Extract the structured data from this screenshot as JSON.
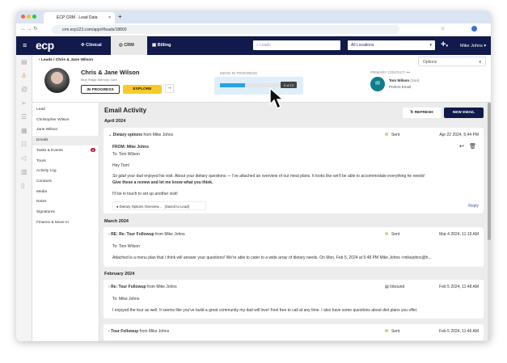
{
  "browser": {
    "tab_title": "ECP CRM - Lead Data",
    "url": "crm.ecp123.com/app/#/leads/18800"
  },
  "nav": {
    "logo": "ecp",
    "items": [
      {
        "label": "Clinical"
      },
      {
        "label": "CRM"
      },
      {
        "label": "Billing"
      }
    ],
    "search_placeholder": "Leads",
    "location": "All Locations",
    "add": "+",
    "user": "Mike Johns"
  },
  "header": {
    "breadcrumb": "Leads / Chris & Jane Wilson",
    "name": "Chris & Jane Wilson",
    "community": "Blue Ridge Memory Care",
    "status_button": "IN PROGRESS",
    "explore_button": "EXPLORE",
    "options": "Options",
    "progress": {
      "label": "MOVE-IN PROGRESS",
      "current": 5,
      "total": 13,
      "text": "5 of 13",
      "color": "#29a3e0"
    },
    "contact": {
      "label": "PRIMARY CONTACT",
      "name": "Tom Wilson",
      "relation": "(Son)",
      "preference": "Prefers Email",
      "color": "#0f7d8c"
    }
  },
  "sidebar": {
    "items": [
      {
        "label": "Lead"
      },
      {
        "label": "Christopher Wilson"
      },
      {
        "label": "Jane Wilson"
      },
      {
        "label": "Emails",
        "selected": true
      },
      {
        "label": "Tasks & Events",
        "badge": "8"
      },
      {
        "label": "Tours"
      },
      {
        "label": "Activity Log"
      },
      {
        "label": "Contacts"
      },
      {
        "label": "Media"
      },
      {
        "label": "Notes"
      },
      {
        "label": "Signatures"
      },
      {
        "label": "Finance & Move In"
      }
    ]
  },
  "emails": {
    "title": "Email Activity",
    "refresh": "REFRESH",
    "new_email": "NEW EMAIL",
    "months": [
      "April 2024",
      "March 2024",
      "February 2024"
    ],
    "items": [
      {
        "subject": "Dietary options",
        "from": "from Mike Johns",
        "status": "Sent",
        "date": "Apr 22 2024, 5:44 PM",
        "from_line": "FROM: Mike Johns",
        "to": "To: Tom Wilson",
        "greeting": "Hey Tom!",
        "body_italic": "So glad",
        "body": " your dad enjoyed his visit. About your dietary questions — I've attached an overview of our meal plans. It looks like we'll be able to accommodate everything he needs!",
        "body_bold": "Give these a review and let me know what you think.",
        "closing": "I'll be in touch to set up another visit!",
        "attachment": "Dietary Options Overview...",
        "attachment_note": "(Saved to Lead)",
        "reply": "Reply"
      },
      {
        "subject": "RE: Re: Tour Followup",
        "from": "from Mike Johns",
        "status": "Sent",
        "date": "Mar 4 2024, 11:19 AM",
        "to": "To: Tom Wilson",
        "preview": "Attached is a menu plan that I think will answer your questions! We're able to cater to a wide array of dietary needs. On Mon, Feb 5, 2024 at 5:48 PM Mike Johns <mikejohns@h..."
      },
      {
        "subject": "Re: Tour Followup",
        "from": "from Mike Johns",
        "status": "Inbound",
        "date": "Feb 5 2024, 11:48 AM",
        "to": "To: Mike Johns",
        "preview": "I enjoyed the tour as well. It seems like you've build a great community my dad will love! Feel free to call at any time. I also have some questions about diet plans you offer."
      },
      {
        "subject": "Tour Followup",
        "from": "from Mike Johns",
        "status": "Sent",
        "date": "Feb 5 2024, 11:46 AM"
      }
    ]
  }
}
